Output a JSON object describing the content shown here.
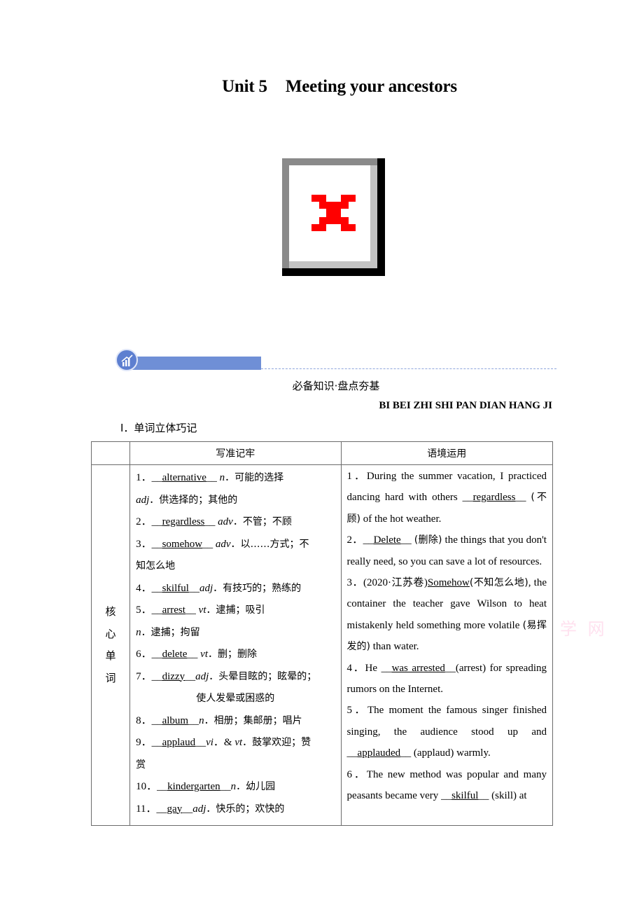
{
  "document": {
    "title_unit": "Unit 5",
    "title_text": "Meeting your ancestors",
    "image_placeholder": "broken-image-icon",
    "section_banner_icon": "growth-chart-icon",
    "section_title_cn": "必备知识·盘点夯基",
    "section_title_pinyin": "BI BEI ZHI SHI PAN DIAN HANG JI",
    "subsection": "Ⅰ．单词立体巧记",
    "watermark": "学 网"
  },
  "table": {
    "headers": [
      "",
      "写准记牢",
      "语境运用"
    ],
    "category": [
      "核",
      "心",
      "单",
      "词"
    ],
    "left_items": [
      {
        "num": "1．",
        "word": "alternative",
        "pos": "n",
        "meaning": "．可能的选择"
      },
      {
        "extra_pos": "adj",
        "extra_meaning": "．供选择的；其他的"
      },
      {
        "num": "2．",
        "word": "regardless",
        "pos": "adv",
        "meaning": "．不管；不顾"
      },
      {
        "num": "3．",
        "word": "somehow",
        "pos": "adv",
        "meaning": "．以……方式；不",
        "cont": "知怎么地"
      },
      {
        "num": "4．",
        "word": "skilful",
        "pos": "adj",
        "meaning": "．有技巧的；熟练的"
      },
      {
        "num": "5．",
        "word": "arrest",
        "pos": "vt",
        "meaning": "．逮捕；吸引"
      },
      {
        "extra_pos": "n",
        "extra_meaning": "．逮捕；拘留"
      },
      {
        "num": "6．",
        "word": "delete",
        "pos": "vt",
        "meaning": "．删；删除"
      },
      {
        "num": "7．",
        "word": "dizzy",
        "pos": "adj",
        "meaning": "．头晕目眩的；眩晕的；",
        "cont": "使人发晕或困惑的"
      },
      {
        "num": "8．",
        "word": "album",
        "pos": "n",
        "meaning": "．相册；集邮册；唱片"
      },
      {
        "num": "9．",
        "word": "applaud",
        "pos": "vi",
        "pos2": "vt",
        "meaning": "．鼓掌欢迎；赞",
        "cont": "赏"
      },
      {
        "num": "10．",
        "word": "kindergarten",
        "pos": "n",
        "meaning": "．幼儿园"
      },
      {
        "num": "11．",
        "word": "gay",
        "pos": "adj",
        "meaning": "．快乐的；欢快的"
      }
    ],
    "right_items": [
      {
        "pre": "1．During the summer vacation, I practiced dancing hard with others ",
        "answer": "regardless",
        "post_cn": "(不顾)",
        "post": " of the hot weather."
      },
      {
        "pre": "2．",
        "answer": "Delete",
        "post_cn": "(删除)",
        "post": " the things that you don't really need, so you can save a lot of resources."
      },
      {
        "pre": "3．(2020·江苏卷)",
        "answer": "Somehow",
        "post_cn": "(不知怎么地)",
        "post": ", the container the teacher gave Wilson to heat mistakenly held something more volatile ",
        "post2_cn": "(易挥发的)",
        "post2": " than water."
      },
      {
        "pre": "4．He ",
        "answer": "was arrested",
        "post": "(arrest) for spreading rumors on the Internet."
      },
      {
        "pre": "5．The moment the famous singer finished singing, the audience stood up and ",
        "answer": "applauded",
        "post": " (applaud) warmly."
      },
      {
        "pre": "6．The new method was popular and many peasants became very ",
        "answer": "skilful",
        "post": " (skill) at"
      }
    ]
  }
}
